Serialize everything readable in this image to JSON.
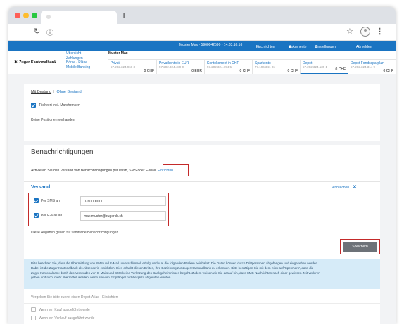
{
  "browser": {
    "newtab_icon": "plus-icon",
    "nav_icons": [
      "reload-icon",
      "info-icon",
      "star-icon",
      "profile-icon",
      "menu-icon"
    ]
  },
  "topbar": {
    "user": "Muster Max · 5960042590 - 14.03.10:16",
    "messages": "Nachrichten",
    "documents": "Dokumente",
    "settings": "Einstellungen",
    "logout": "Abmelden",
    "bg_color": "#1a74c2"
  },
  "header": {
    "logo_text": "Zuger Kantonalbank",
    "links": [
      "Übersicht",
      "Zahlungen",
      "Börse / Pläne",
      "Mobile Banking"
    ],
    "owner": "Muster Max",
    "accounts": [
      {
        "name": "Privat",
        "number": "57.202.324.966 3",
        "balance": "0 CHF"
      },
      {
        "name": "Privatkonto in EUR",
        "number": "57.202.324.489 0",
        "balance": "0 EUR"
      },
      {
        "name": "Kontokorrent in CHF",
        "number": "57.202.324.794 5",
        "balance": "0 CHF"
      },
      {
        "name": "Sparkonto",
        "number": "77.196.341 06",
        "balance": "0 CHF"
      },
      {
        "name": "Depot",
        "number": "57.202.324.139 1",
        "balance": "0 CHF"
      },
      {
        "name": "Depot Fondssparplan",
        "number": "57.202.324.314 9",
        "balance": "0 CHF"
      }
    ]
  },
  "positions": {
    "tab_with": "Mit Bestand",
    "tab_without": "Ohne Bestand",
    "checkbox_label": "Titelwert inkl. Marchzinsen",
    "empty_text": "Keine Positionen vorhanden"
  },
  "notifications": {
    "title": "Benachrichtigungen",
    "description": "Aktivieren Sie den Versand von Benachrichtigungen per Push, SMS oder E-Mail.",
    "setup_link": "Einrichten",
    "section_title": "Versand",
    "cancel_link": "Abbrechen",
    "sms_label": "Per SMS an",
    "sms_value": "0760000000",
    "email_label": "Per E-Mail an",
    "email_value": "max.muster@zugerkb.ch",
    "note": "Diese Angaben gelten für sämtliche Benachrichtigungen.",
    "save_button": "Speichern",
    "info_lines": [
      "Bitte beachten Sie, dass die Übermittlung von SMS und E-Mail unverschlüsselt erfolgt und u.a. die folgenden Risiken beinhaltet: Die Daten können durch Drittpersonen abgefangen und eingesehen werden.",
      "Dabei ist die Zuger Kantonalbank als Absenderin ersichtlich. Dies erlaubt diesen Dritten, ihre Beziehung zur Zuger Kantonalbank zu erkennen. Bitte bestätigen Sie mit dem Klick auf 'Speichern', dass die",
      "Zuger Kantonalbank durch das Versenden von E-Mails und SMS keine Verletzung des Bankgeheimnisses begeht. Zudem weisen wir Sie darauf hin, dass SMS-Nachrichten nach einer gewissen Zeit verloren",
      "gehen und nicht mehr übermittelt werden, wenn sie vom Empfänger nicht explizit abgerufen werden."
    ],
    "hint": "Vergeben Sie bitte zuerst einen Depot-Alias · Einrichten",
    "rules": [
      "Wenn ein Kauf ausgeführt wurde",
      "Wenn ein Verkauf ausgeführt wurde"
    ]
  }
}
